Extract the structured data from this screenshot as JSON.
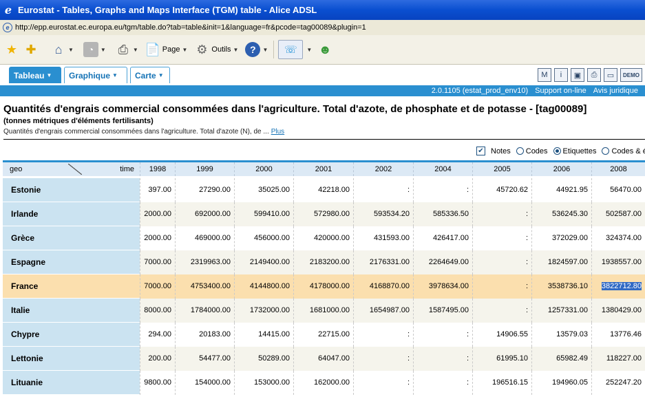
{
  "browser": {
    "title": "Eurostat - Tables, Graphs and Maps Interface (TGM) table - Alice ADSL",
    "url": "http://epp.eurostat.ec.europa.eu/tgm/table.do?tab=table&init=1&language=fr&pcode=tag00089&plugin=1",
    "toolbar": {
      "page_label": "Page",
      "tools_label": "Outils"
    }
  },
  "tabs": [
    {
      "label": "Tableau"
    },
    {
      "label": "Graphique"
    },
    {
      "label": "Carte"
    }
  ],
  "top_icons": {
    "demo_label": "DEMO"
  },
  "info_bar": {
    "version": "2.0.1105 (estat_prod_env10)",
    "support": "Support on-line",
    "legal": "Avis juridique"
  },
  "page": {
    "title": "Quantités d'engrais commercial consommées dans l'agriculture. Total d'azote, de phosphate et de potasse - [tag00089]",
    "subtitle": "(tonnes métriques d'éléments fertilisants)",
    "description": "Quantités d'engrais commercial consommées dans l'agriculture. Total d'azote (N), de ...",
    "more_link": "Plus"
  },
  "options": {
    "notes": "Notes",
    "codes": "Codes",
    "labels": "Etiquettes",
    "codes_labels": "Codes & é"
  },
  "table": {
    "geo_label": "geo",
    "time_label": "time",
    "years": [
      "1998",
      "1999",
      "2000",
      "2001",
      "2002",
      "2004",
      "2005",
      "2006",
      "2008"
    ],
    "rows": [
      {
        "geo": "Estonie",
        "values": [
          "397.00",
          "27290.00",
          "35025.00",
          "42218.00",
          ":",
          ":",
          "45720.62",
          "44921.95",
          "56470.00"
        ]
      },
      {
        "geo": "Irlande",
        "values": [
          "2000.00",
          "692000.00",
          "599410.00",
          "572980.00",
          "593534.20",
          "585336.50",
          ":",
          "536245.30",
          "502587.00"
        ]
      },
      {
        "geo": "Grèce",
        "values": [
          "2000.00",
          "469000.00",
          "456000.00",
          "420000.00",
          "431593.00",
          "426417.00",
          ":",
          "372029.00",
          "324374.00"
        ]
      },
      {
        "geo": "Espagne",
        "values": [
          "7000.00",
          "2319963.00",
          "2149400.00",
          "2183200.00",
          "2176331.00",
          "2264649.00",
          ":",
          "1824597.00",
          "1938557.00"
        ]
      },
      {
        "geo": "France",
        "values": [
          "7000.00",
          "4753400.00",
          "4144800.00",
          "4178000.00",
          "4168870.00",
          "3978634.00",
          ":",
          "3538736.10",
          "3822712.80"
        ]
      },
      {
        "geo": "Italie",
        "values": [
          "8000.00",
          "1784000.00",
          "1732000.00",
          "1681000.00",
          "1654987.00",
          "1587495.00",
          ":",
          "1257331.00",
          "1380429.00"
        ]
      },
      {
        "geo": "Chypre",
        "values": [
          "294.00",
          "20183.00",
          "14415.00",
          "22715.00",
          ":",
          ":",
          "14906.55",
          "13579.03",
          "13776.46"
        ]
      },
      {
        "geo": "Lettonie",
        "values": [
          "200.00",
          "54477.00",
          "50289.00",
          "64047.00",
          ":",
          ":",
          "61995.10",
          "65982.49",
          "118227.00"
        ]
      },
      {
        "geo": "Lituanie",
        "values": [
          "9800.00",
          "154000.00",
          "153000.00",
          "162000.00",
          ":",
          ":",
          "196516.15",
          "194960.05",
          "252247.20"
        ]
      }
    ]
  }
}
